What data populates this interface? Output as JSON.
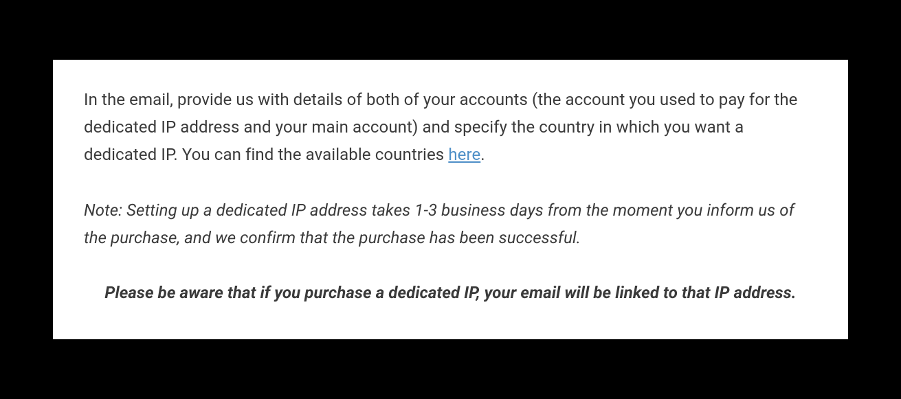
{
  "intro": {
    "part1": "In the email, provide us with details of both of your accounts (the account you used to pay for the dedicated IP address and your main account) and specify the country in which you want a dedicated IP. You can find the available countries ",
    "link_text": "here",
    "part2": "."
  },
  "note": "Note: Setting up a dedicated IP address takes 1-3 business days from the moment you inform us of the purchase, and we confirm that the purchase has been successful.",
  "warning": "Please be aware that if you purchase a dedicated IP, your email will be linked to that IP address."
}
